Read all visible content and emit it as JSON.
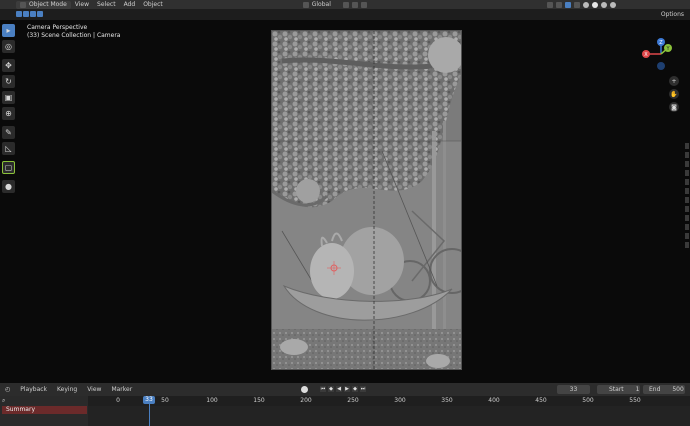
{
  "topbar": {
    "mode_label": "Object Mode",
    "menu": [
      "View",
      "Select",
      "Add",
      "Object"
    ],
    "transform_orientation": "Global",
    "options_label": "Options"
  },
  "viewport": {
    "view_name": "Camera Perspective",
    "collection_info": "(33) Scene Collection | Camera"
  },
  "gizmo": {
    "axes": [
      "X",
      "Y",
      "Z"
    ]
  },
  "timeline": {
    "menu": [
      "Playback",
      "Keying",
      "View",
      "Marker"
    ],
    "current_frame": "33",
    "start_label": "Start",
    "start_value": "1",
    "end_label": "End",
    "end_value": "500",
    "ruler_ticks": [
      "0",
      "50",
      "100",
      "150",
      "200",
      "250",
      "300",
      "350",
      "400",
      "450",
      "500",
      "550"
    ],
    "summary_label": "Summary"
  },
  "colors": {
    "accent": "#4a7fc1",
    "x_axis": "#e0474a",
    "y_axis": "#8bc23a",
    "z_axis": "#3d7ad6"
  },
  "icons": {
    "tools": [
      "cursor-icon",
      "crosshair-icon",
      "move-icon",
      "rotate-icon",
      "scale-icon",
      "transform-icon",
      "annotate-icon",
      "measure-icon",
      "add-cube-icon"
    ],
    "nav": [
      "zoom-icon",
      "hand-icon",
      "camera-icon"
    ]
  }
}
